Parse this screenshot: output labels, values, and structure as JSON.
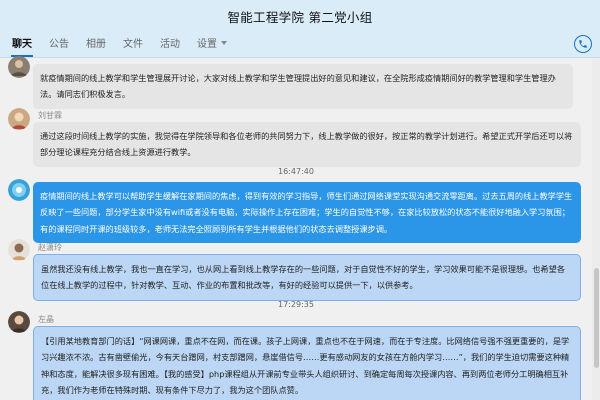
{
  "window": {
    "title": "智能工程学院 第二党小组"
  },
  "tabs": [
    {
      "label": "聊天",
      "active": true
    },
    {
      "label": "公告",
      "active": false
    },
    {
      "label": "相册",
      "active": false
    },
    {
      "label": "文件",
      "active": false
    },
    {
      "label": "活动",
      "active": false
    },
    {
      "label": "设置",
      "active": false
    }
  ],
  "messages": [
    {
      "sender": "",
      "text": "就疫情期间的线上教学和学生管理展开讨论，大家对线上教学和学生管理提出好的意见和建议，在全院形成疫情期间好的教学管理和学生管理办法。请同志们积极发言。"
    },
    {
      "sender": "刘甘霖",
      "text": "通过这段时间线上教学的实施，我觉得在学院领导和各位老师的共同努力下，线上教学做的很好，按正常的教学计划进行。希望正式开学后还可以将部分理论课程充分结合线上资源进行教学。"
    },
    {
      "time": "16:47:40"
    },
    {
      "sender": "",
      "text": "疫情期间的线上教学可以帮助学生缓解在家期间的焦虑，得到有效的学习指导，师生们通过网络课堂实现沟通交流零距离。过去五周的线上教学学生反映了一些问题，部分学生家中没有wifi或者没有电脑，实际操作上存在困难；学生的自觉性不够，在家比较放松的状态不能很好地融入学习氛围；有的课程同时开课的班级较多，老师无法完全照顾到所有学生并根据他们的状态去调整授课步调。"
    },
    {
      "sender": "赵潇玲",
      "text": "虽然我还没有线上教学，我也一直在学习，也从网上看到线上教学存在的一些问题，对于自觉性不好的学生，学习效果可能不是很理想。也希望各位在线上教学的过程中，针对教学、互动、作业的布置和批改等，有好的经验可以提供一下，以供参考。"
    },
    {
      "time": "17:29:35"
    },
    {
      "sender": "左晶",
      "text": "【引用某地教育部门的话】“网课网课，重点不在网，而在课。孩子上网课，重点也不在于网速，而在于专注度。比网络信号强不强更重要的，是学习兴趣浓不浓。古有凿壁偷光，今有天台蹭网，村支部蹭网，悬崖借信号……更有感动网友的女孩在方舱内学习……”，我们的学生迫切需要这种精神和态度，能解决很多现有困难。【我的感受】php课程组从开课前专业带头人组织研讨、到确定每周每次授课内容、再到两位老师分工明确相互补充，我们作为老师在特殊时期、现有条件下尽力了，我为这个团队点赞。"
    }
  ],
  "colors": {
    "accent": "#1a6fc4",
    "bubble_grey": "#e5e5e5",
    "bubble_blue": "#2b95e8",
    "bubble_lightblue": "#bcd7f5"
  }
}
